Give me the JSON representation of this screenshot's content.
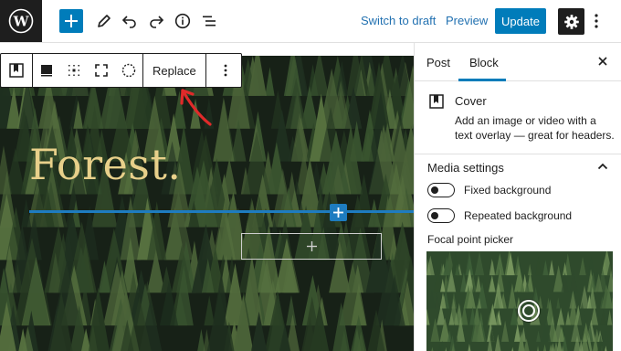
{
  "topbar": {
    "logo_icon": "wordpress-logo",
    "add_icon": "plus-icon",
    "tools_icon": "pencil-icon",
    "undo_icon": "undo-icon",
    "redo_icon": "redo-icon",
    "details_icon": "info-icon",
    "outline_icon": "list-view-icon",
    "switch_to_draft": "Switch to draft",
    "preview": "Preview",
    "update": "Update",
    "settings_icon": "gear-icon",
    "more_icon": "more-vertical-icon"
  },
  "colors": {
    "accent": "#007cba",
    "dark": "#1e1e1e",
    "inserter_blue": "#1e7cc0",
    "title_gold": "#e8d08a",
    "annotation_red": "#e02a2a",
    "forest_dark": "#1b261a"
  },
  "block_toolbar": {
    "icons": [
      "cover-block-icon",
      "overlay-color-icon",
      "content-position-icon",
      "full-height-icon",
      "media-circle-icon"
    ],
    "replace": "Replace",
    "more_icon": "more-vertical-icon"
  },
  "canvas": {
    "cover_title": "Forest.",
    "inserter_icon": "plus-icon",
    "appender_icon": "plus-icon"
  },
  "sidebar": {
    "tabs": [
      {
        "label": "Post",
        "active": false
      },
      {
        "label": "Block",
        "active": true
      }
    ],
    "close_icon": "close-icon",
    "block": {
      "icon": "cover-block-icon",
      "name": "Cover",
      "description": "Add an image or video with a text overlay — great for headers."
    },
    "media_settings": {
      "title": "Media settings",
      "chevron_icon": "chevron-up-icon",
      "toggles": [
        {
          "label": "Fixed background",
          "checked": false
        },
        {
          "label": "Repeated background",
          "checked": false
        }
      ],
      "focal_label": "Focal point picker"
    }
  }
}
